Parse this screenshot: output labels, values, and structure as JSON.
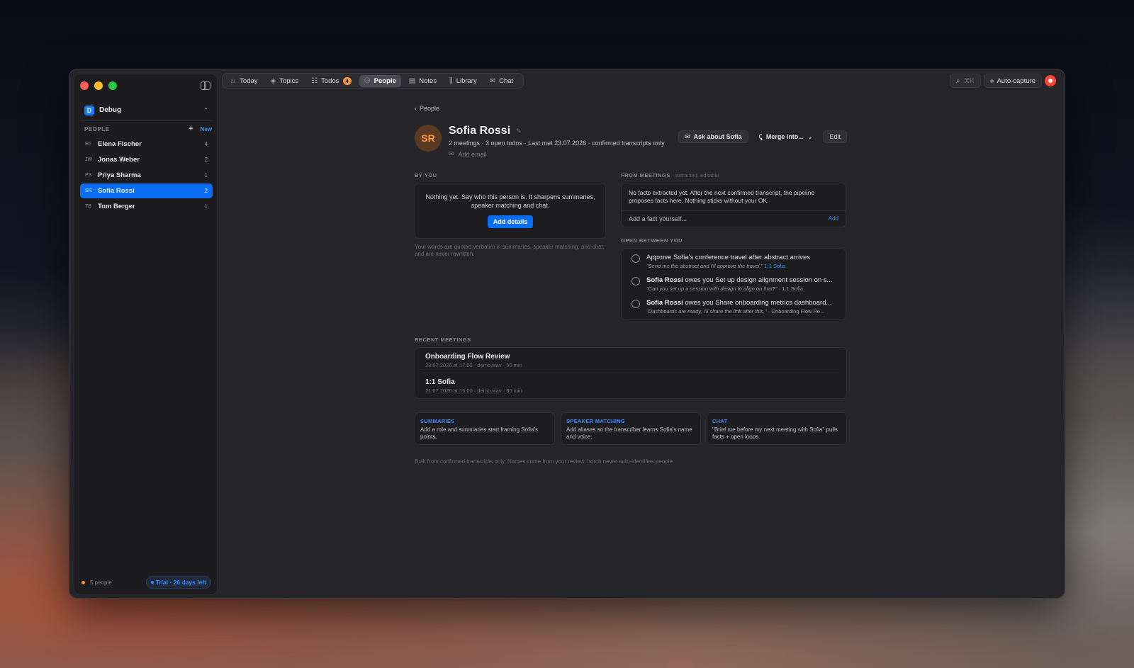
{
  "sidebar": {
    "workspace": {
      "initial": "D",
      "name": "Debug"
    },
    "people_label": "PEOPLE",
    "new_label": "New",
    "people": [
      {
        "initials": "EF",
        "name": "Elena Fischer",
        "count": "4",
        "active": false
      },
      {
        "initials": "JW",
        "name": "Jonas Weber",
        "count": "2",
        "active": false
      },
      {
        "initials": "PS",
        "name": "Priya Sharma",
        "count": "1",
        "active": false
      },
      {
        "initials": "SR",
        "name": "Sofia Rossi",
        "count": "2",
        "active": true
      },
      {
        "initials": "TB",
        "name": "Tom Berger",
        "count": "1",
        "active": false
      }
    ],
    "footer_count": "5 people",
    "trial": "Trial · 26 days left"
  },
  "toolbar": {
    "tabs": [
      {
        "label": "Today",
        "icon": "sun-icon"
      },
      {
        "label": "Topics",
        "icon": "layers-icon"
      },
      {
        "label": "Todos",
        "icon": "checklist-icon",
        "badge": "4"
      },
      {
        "label": "People",
        "icon": "people-icon",
        "active": true
      },
      {
        "label": "Notes",
        "icon": "note-icon"
      },
      {
        "label": "Library",
        "icon": "library-icon"
      },
      {
        "label": "Chat",
        "icon": "chat-icon"
      }
    ],
    "search_shortcut": "⌘K",
    "auto_capture": "Auto-capture"
  },
  "main": {
    "back_label": "People",
    "profile": {
      "initials": "SR",
      "name": "Sofia Rossi",
      "subtitle": "2 meetings · 3 open todos · Last met 23.07.2026 · confirmed transcripts only",
      "add_email": "Add email",
      "ask_label": "Ask about Sofia",
      "merge_label": "Merge into...",
      "edit_label": "Edit"
    },
    "by_you": {
      "label": "BY YOU",
      "text": "Nothing yet. Say who this person is. It sharpens summaries, speaker matching and chat.",
      "button": "Add details",
      "note": "Your words are quoted verbatim in summaries, speaker matching, and chat, and are never rewritten."
    },
    "from_meetings": {
      "label": "FROM MEETINGS",
      "sublabel": "· extracted, editable",
      "message": "No facts extracted yet. After the next confirmed transcript, the pipeline proposes facts here. Nothing sticks without your OK.",
      "add_placeholder": "Add a fact yourself...",
      "add_button": "Add"
    },
    "open_between": {
      "label": "OPEN BETWEEN YOU",
      "todos": [
        {
          "who": "",
          "title": "Approve Sofia's conference travel after abstract arrives",
          "quote": "\"Send me the abstract and I'll approve the travel.\"",
          "ref": "1:1 Sofia"
        },
        {
          "who": "Sofia Rossi",
          "title": " owes you Set up design alignment session on s...",
          "quote": "\"Can you set up a session with design to align on that?\"",
          "ref": " · 1:1 Sofia"
        },
        {
          "who": "Sofia Rossi",
          "title": " owes you Share onboarding metrics dashboard...",
          "quote": "\"Dashboards are ready, I'll share the link after this.\"",
          "ref": " · Onboarding Flow Re..."
        }
      ]
    },
    "recent_meetings": {
      "label": "RECENT MEETINGS",
      "items": [
        {
          "title": "Onboarding Flow Review",
          "meta": "23.07.2026 at 17:00 · demo.wav · 50 min"
        },
        {
          "title": "1:1 Sofia",
          "meta": "21.07.2026 at 13:00 · demo.wav · 30 min"
        }
      ]
    },
    "hints": [
      {
        "title": "SUMMARIES",
        "body": "Add a role and summaries start framing Sofia's points."
      },
      {
        "title": "SPEAKER MATCHING",
        "body": "Add aliases so the transcriber learns Sofia's name and voice."
      },
      {
        "title": "CHAT",
        "body": "\"Brief me before my next meeting with Sofia\" pulls facts + open loops."
      }
    ],
    "footer": "Built from confirmed transcripts only. Names come from your review. horch never auto-identifies people."
  }
}
